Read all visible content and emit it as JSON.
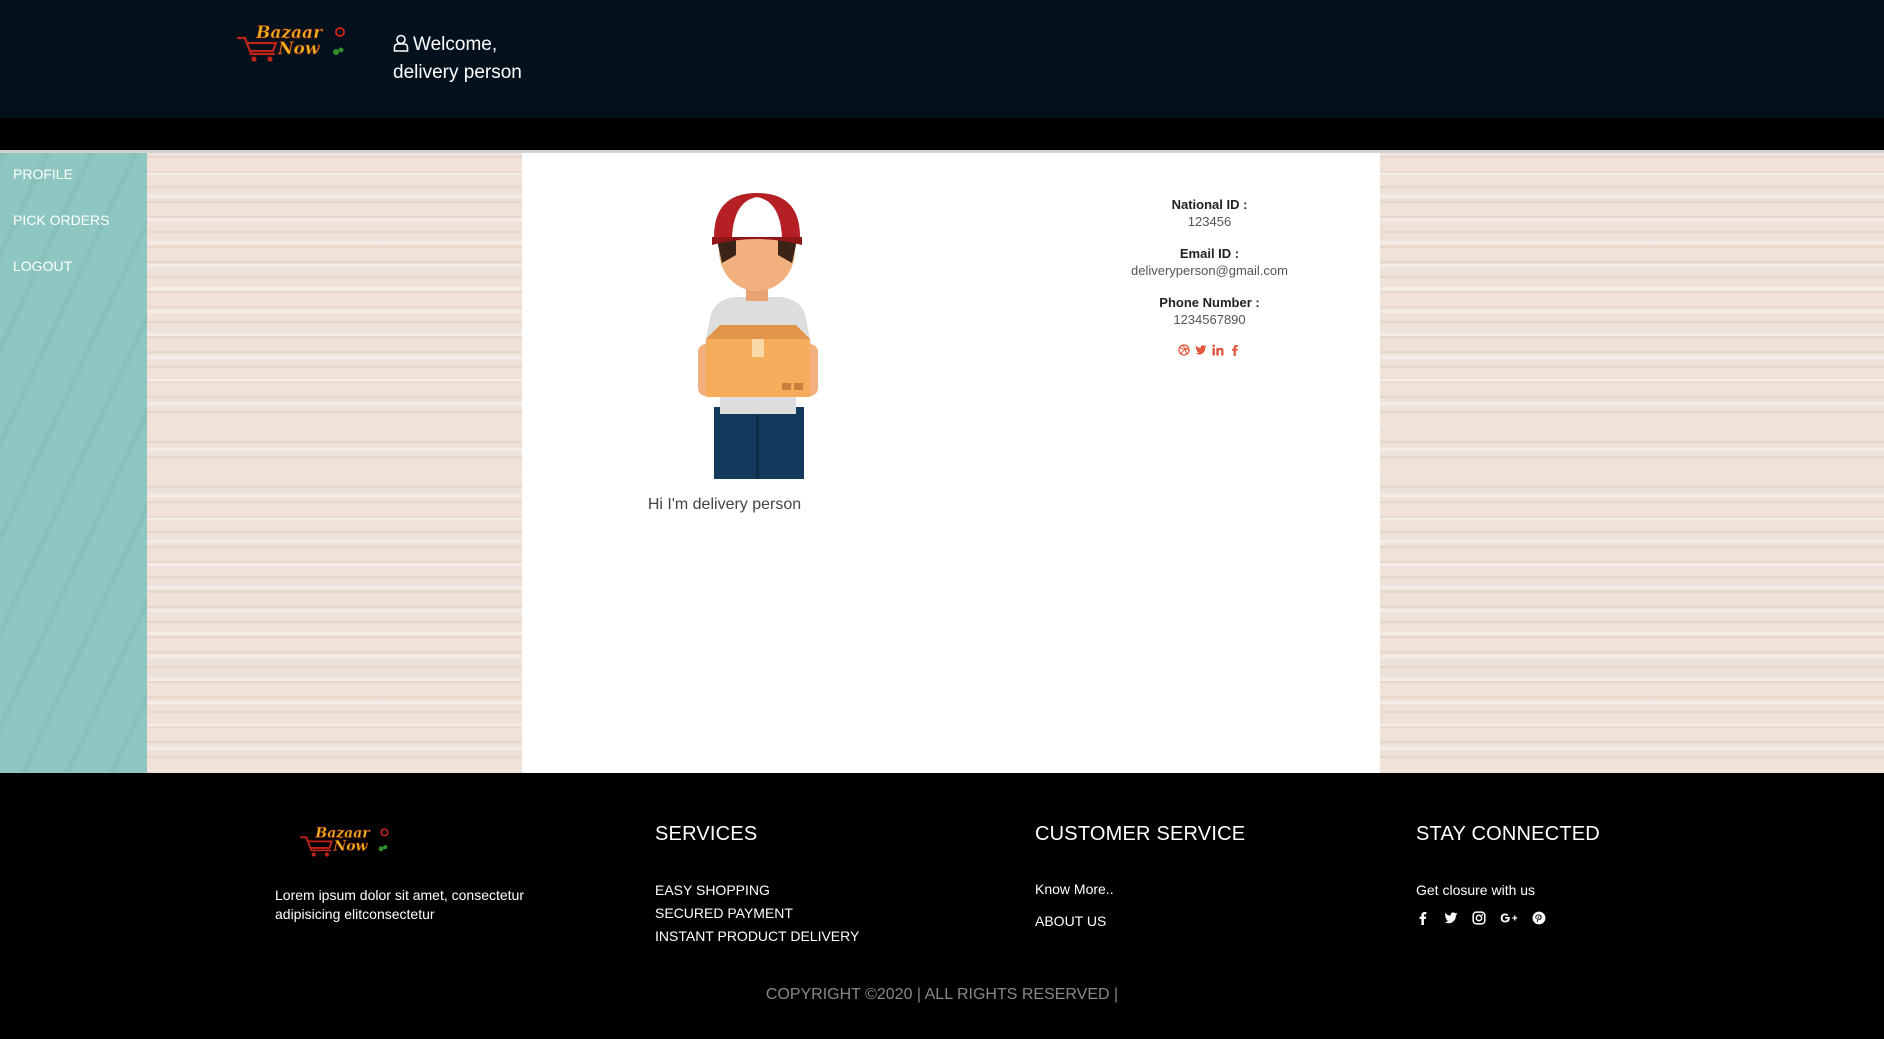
{
  "header": {
    "logo_text": "Bazaar Now",
    "welcome_line1": "Welcome,",
    "welcome_line2": "delivery person"
  },
  "sidebar": {
    "items": [
      {
        "label": "PROFILE"
      },
      {
        "label": "PICK ORDERS"
      },
      {
        "label": "LOGOUT"
      }
    ]
  },
  "profile": {
    "greeting": "Hi I'm delivery person",
    "avatar_icon": "delivery-person-avatar",
    "fields": [
      {
        "label": "National ID :",
        "value": "123456"
      },
      {
        "label": "Email ID :",
        "value": "deliveryperson@gmail.com"
      },
      {
        "label": "Phone Number :",
        "value": "1234567890"
      }
    ],
    "social_icons": [
      "dribbble-icon",
      "twitter-icon",
      "linkedin-icon",
      "facebook-icon"
    ],
    "social_color": "#e2543b"
  },
  "footer": {
    "logo_text": "Bazaar Now",
    "description": "Lorem ipsum dolor sit amet, consectetur adipisicing elitconsectetur",
    "services": {
      "title": "SERVICES",
      "links": [
        "EASY SHOPPING",
        "SECURED PAYMENT",
        "INSTANT PRODUCT DELIVERY"
      ]
    },
    "customer_service": {
      "title": "CUSTOMER SERVICE",
      "links": [
        "Know More..",
        "ABOUT US"
      ]
    },
    "stay_connected": {
      "title": "STAY CONNECTED",
      "text": "Get closure with us",
      "icons": [
        "facebook-icon",
        "twitter-icon",
        "instagram-icon",
        "google-plus-icon",
        "pinterest-icon"
      ]
    },
    "copyright": "COPYRIGHT ©2020 | ALL RIGHTS RESERVED |"
  },
  "colors": {
    "header_bg": "#03111c",
    "sidebar_bg": "#8ec6c2",
    "background": "#efe2d9",
    "card_bg": "#ffffff",
    "footer_bg": "#000000",
    "accent": "#e2543b"
  }
}
